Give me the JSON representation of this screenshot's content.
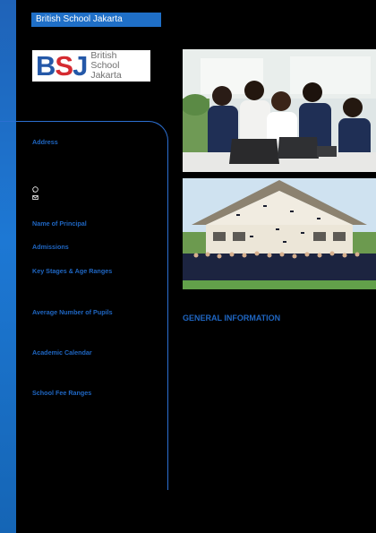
{
  "header": {
    "title": "British School Jakarta"
  },
  "logo": {
    "mark_b": "B",
    "mark_s": "S",
    "mark_j": "J",
    "line1": "British",
    "line2": "School",
    "line3": "Jakarta"
  },
  "info_labels": {
    "address": "Address",
    "principal": "Name of Principal",
    "admissions": "Admissions",
    "key_stages": "Key Stages & Age Ranges",
    "avg_pupils": "Average Number of Pupils",
    "calendar": "Academic Calendar",
    "fee_ranges": "School Fee Ranges"
  },
  "contact_icons": [
    "whatsapp-icon",
    "email-icon"
  ],
  "main": {
    "section_heading": "GENERAL INFORMATION"
  },
  "colors": {
    "accent": "#1f66c2",
    "brand_red": "#d52b31",
    "background": "#000000"
  }
}
